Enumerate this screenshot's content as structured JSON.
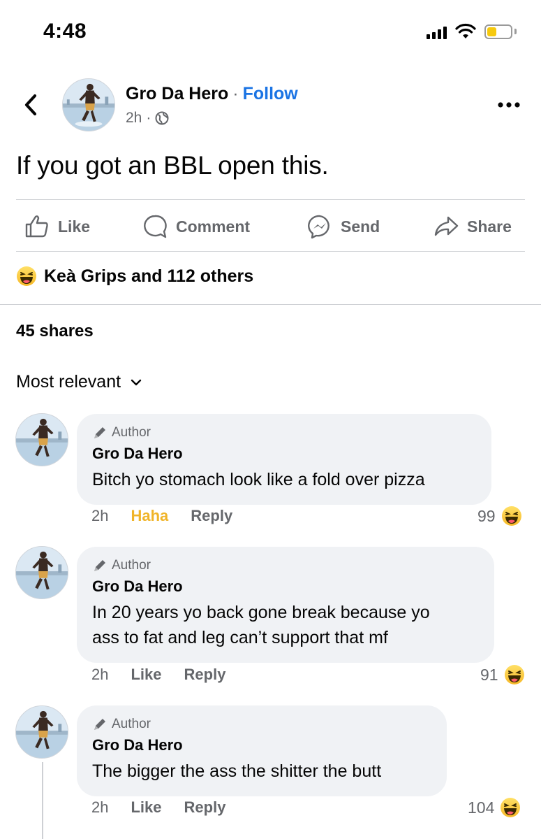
{
  "status_bar": {
    "time": "4:48"
  },
  "post": {
    "author": "Gro Da Hero",
    "separator": "·",
    "follow": "Follow",
    "time": "2h",
    "meta_separator": "·",
    "text": "If you got an BBL open this."
  },
  "actions": [
    {
      "label": "Like",
      "icon": "thumbs-up-icon"
    },
    {
      "label": "Comment",
      "icon": "comment-icon"
    },
    {
      "label": "Send",
      "icon": "messenger-icon"
    },
    {
      "label": "Share",
      "icon": "share-icon"
    }
  ],
  "reactions": {
    "summary": "Keà Grips and 112 others",
    "icon": "haha-emoji-icon"
  },
  "shares": "45 shares",
  "sort": {
    "label": "Most relevant"
  },
  "colors": {
    "accent": "#1b74e4",
    "haha": "#f0b429",
    "bubble": "#f0f2f5",
    "muted": "#65676b"
  },
  "comments": [
    {
      "badge": "Author",
      "author": "Gro Da Hero",
      "text": [
        "Bitch yo stomach look like a fold over pizza"
      ],
      "time": "2h",
      "like_label": "Haha",
      "reply_label": "Reply",
      "reaction_count": "99"
    },
    {
      "badge": "Author",
      "author": "Gro Da Hero",
      "text": [
        "In 20 years yo back gone break because yo",
        "ass to fat and leg can’t support that mf"
      ],
      "time": "2h",
      "like_label": "Like",
      "reply_label": "Reply",
      "reaction_count": "91"
    },
    {
      "badge": "Author",
      "author": "Gro Da Hero",
      "text": [
        "The bigger the ass the shitter the butt"
      ],
      "time": "2h",
      "like_label": "Like",
      "reply_label": "Reply",
      "reaction_count": "104"
    }
  ]
}
